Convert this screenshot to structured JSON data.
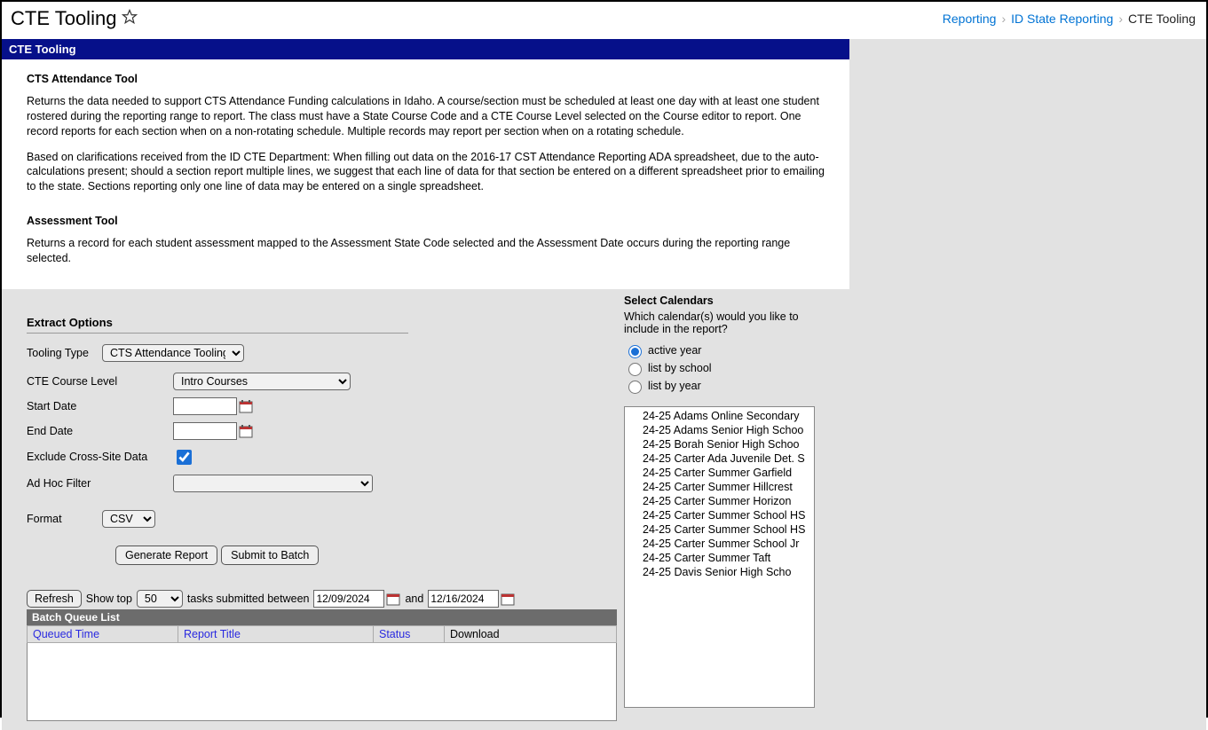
{
  "header": {
    "title": "CTE Tooling",
    "breadcrumb": [
      "Reporting",
      "ID State Reporting",
      "CTE Tooling"
    ]
  },
  "blueBar": "CTE Tooling",
  "desc": {
    "h1": "CTS Attendance Tool",
    "p1": "Returns the data needed to support CTS Attendance Funding calculations in Idaho. A course/section must be scheduled at least one day with at least one student rostered during the reporting range to report. The class must have a State Course Code and a CTE Course Level selected on the Course editor to report. One record reports for each section when on a non-rotating schedule. Multiple records may report per section when on a rotating schedule.",
    "p2": "Based on clarifications received from the ID CTE Department: When filling out data on the 2016-17 CST Attendance Reporting ADA spreadsheet, due to the auto-calculations present; should a section report multiple lines, we suggest that each line of data for that section be entered on a different spreadsheet prior to emailing to the state. Sections reporting only one line of data may be entered on a single spreadsheet.",
    "h2": "Assessment Tool",
    "p3": "Returns a record for each student assessment mapped to the Assessment State Code selected and the Assessment Date occurs during the reporting range selected."
  },
  "extract": {
    "heading": "Extract Options",
    "labels": {
      "toolingType": "Tooling Type",
      "cteCourseLevel": "CTE Course Level",
      "startDate": "Start Date",
      "endDate": "End Date",
      "exclude": "Exclude Cross-Site Data",
      "adhoc": "Ad Hoc Filter",
      "format": "Format"
    },
    "values": {
      "toolingType": "CTS Attendance Tooling",
      "cteCourseLevel": "Intro Courses",
      "startDate": "",
      "endDate": "",
      "excludeChecked": true,
      "adhoc": "",
      "format": "CSV"
    },
    "buttons": {
      "generate": "Generate Report",
      "submit": "Submit to Batch"
    }
  },
  "queue": {
    "refresh": "Refresh",
    "showTop": "Show top",
    "topValue": "50",
    "between": "tasks submitted between",
    "date1": "12/09/2024",
    "and": "and",
    "date2": "12/16/2024",
    "listHeading": "Batch Queue List",
    "cols": [
      "Queued Time",
      "Report Title",
      "Status",
      "Download"
    ]
  },
  "calendars": {
    "heading": "Select Calendars",
    "sub": "Which calendar(s) would you like to include in the report?",
    "radios": [
      "active year",
      "list by school",
      "list by year"
    ],
    "selectedRadio": 0,
    "items": [
      "24-25 Adams Online Secondary",
      "24-25 Adams Senior High Schoo",
      "24-25 Borah Senior High Schoo",
      "24-25 Carter Ada Juvenile Det. S",
      "24-25 Carter Summer Garfield",
      "24-25 Carter Summer Hillcrest",
      "24-25 Carter Summer Horizon",
      "24-25 Carter Summer School HS",
      "24-25 Carter Summer School HS",
      "24-25 Carter Summer School Jr",
      "24-25 Carter Summer Taft",
      "24-25 Davis Senior High Scho"
    ]
  }
}
